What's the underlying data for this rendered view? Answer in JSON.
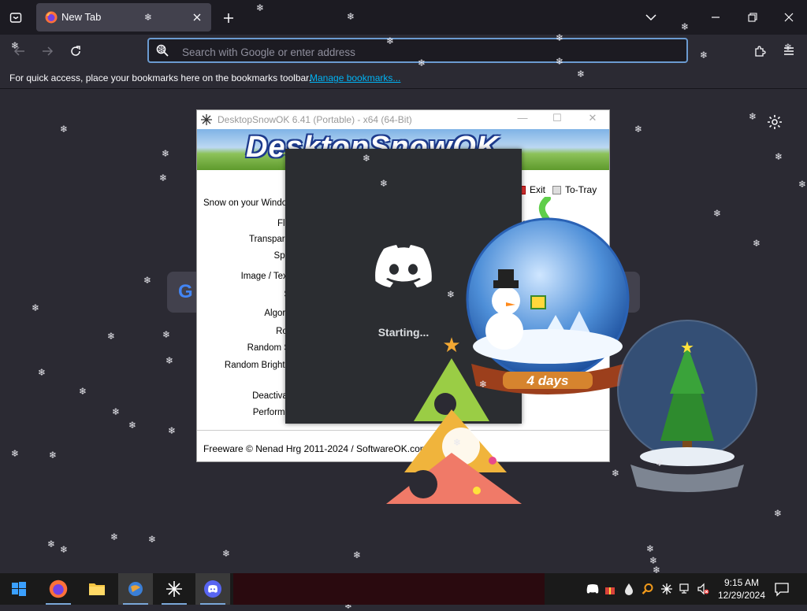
{
  "browser": {
    "tab": {
      "title": "New Tab"
    },
    "urlbar": {
      "placeholder": "Search with Google or enter address"
    },
    "bookmarks_bar": {
      "message": "For quick access, place your bookmarks here on the bookmarks toolbar.",
      "manage_link": "Manage bookmarks..."
    },
    "accent_color": "#00b3f4"
  },
  "newtab": {
    "search_logo": "G"
  },
  "snowok": {
    "title": "DesktopSnowOK 6.41 (Portable) - x64 (64-Bit)",
    "banner_text": "DesktopSnowOK",
    "labels": [
      "Snow on your Windo",
      "Fla",
      "Transpare",
      "Spe",
      "Image / Text",
      "S",
      "Algorit",
      "Rot",
      "Random S",
      "Random Brightn",
      "Deactivat",
      "Performa"
    ],
    "buttons": {
      "exit": "Exit",
      "to_tray": "To-Tray"
    },
    "partial_text": "eact",
    "footer": "Freeware © Nenad Hrg 2011-2024 / SoftwareOK.com"
  },
  "discord_splash": {
    "status": "Starting..."
  },
  "snowglobe": {
    "countdown": "4 days"
  },
  "taskbar": {
    "time": "9:15 AM",
    "date": "12/29/2024"
  }
}
